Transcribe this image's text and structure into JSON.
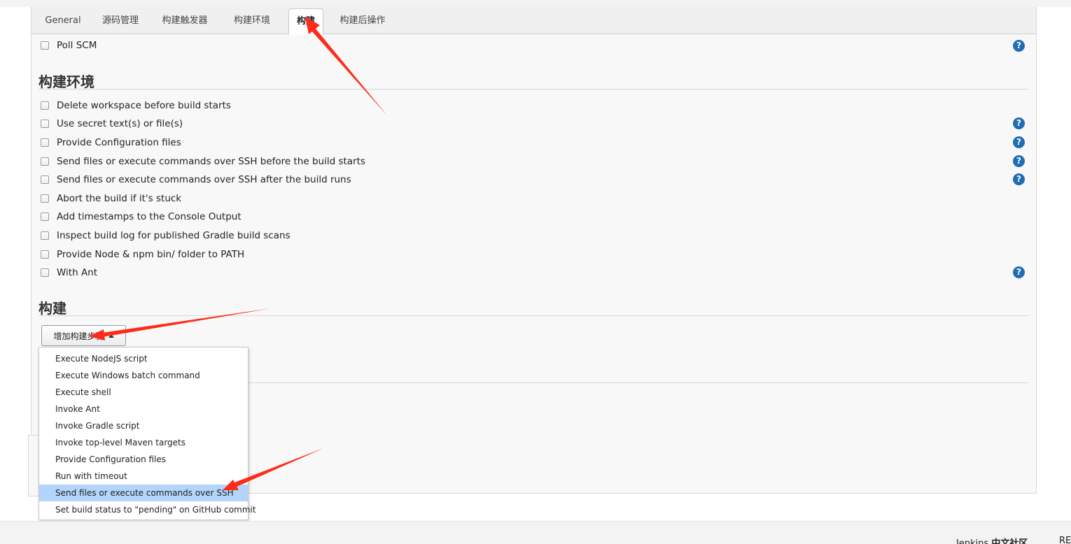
{
  "tabs": [
    {
      "label": "General"
    },
    {
      "label": "源码管理"
    },
    {
      "label": "构建触发器"
    },
    {
      "label": "构建环境"
    },
    {
      "label": "构建",
      "active": true
    },
    {
      "label": "构建后操作"
    }
  ],
  "triggers": {
    "poll_scm": {
      "label": "Poll SCM",
      "checked": false
    }
  },
  "build_env": {
    "title": "构建环境",
    "options": [
      {
        "label": "Delete workspace before build starts",
        "checked": false,
        "help": false
      },
      {
        "label": "Use secret text(s) or file(s)",
        "checked": false,
        "help": true
      },
      {
        "label": "Provide Configuration files",
        "checked": false,
        "help": true
      },
      {
        "label": "Send files or execute commands over SSH before the build starts",
        "checked": false,
        "help": true
      },
      {
        "label": "Send files or execute commands over SSH after the build runs",
        "checked": false,
        "help": true
      },
      {
        "label": "Abort the build if it's stuck",
        "checked": false,
        "help": false
      },
      {
        "label": "Add timestamps to the Console Output",
        "checked": false,
        "help": false
      },
      {
        "label": "Inspect build log for published Gradle build scans",
        "checked": false,
        "help": false
      },
      {
        "label": "Provide Node & npm bin/ folder to PATH",
        "checked": false,
        "help": false
      },
      {
        "label": "With Ant",
        "checked": false,
        "help": true
      }
    ]
  },
  "build": {
    "title": "构建",
    "add_step_label": "增加构建步骤",
    "menu": [
      {
        "label": "Execute NodeJS script"
      },
      {
        "label": "Execute Windows batch command"
      },
      {
        "label": "Execute shell"
      },
      {
        "label": "Invoke Ant"
      },
      {
        "label": "Invoke Gradle script"
      },
      {
        "label": "Invoke top-level Maven targets"
      },
      {
        "label": "Provide Configuration files"
      },
      {
        "label": "Run with timeout"
      },
      {
        "label": "Send files or execute commands over SSH",
        "highlighted": true
      },
      {
        "label": "Set build status to \"pending\" on GitHub commit"
      }
    ]
  },
  "help_glyph": "?",
  "footer": {
    "brand": "Jenkins",
    "community": "中文社区",
    "edge_text": "RE"
  },
  "colors": {
    "help_icon": "#1f6db5",
    "menu_highlight": "#b3d4fb",
    "annotation_arrow": "#ff2a1a"
  }
}
